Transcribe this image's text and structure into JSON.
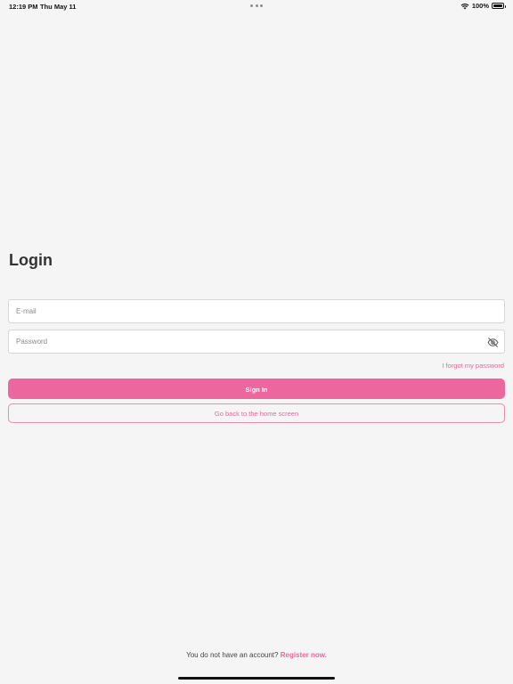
{
  "status_bar": {
    "time": "12:19 PM",
    "date": "Thu May 11",
    "battery_percent": "100%"
  },
  "login": {
    "title": "Login",
    "email_placeholder": "E-mail",
    "password_placeholder": "Password",
    "forgot_password": "I forgot my password",
    "sign_in_label": "Sign In",
    "home_label": "Go back to the home screen"
  },
  "footer": {
    "prompt": "You do not have an account?",
    "register_label": "Register now."
  },
  "colors": {
    "accent": "#ec679e",
    "background": "#f5f5f5"
  },
  "icons": {
    "status": [
      "wifi-icon",
      "battery-icon",
      "multitasking-dots-icon"
    ],
    "password_toggle": "eye-off-icon"
  }
}
